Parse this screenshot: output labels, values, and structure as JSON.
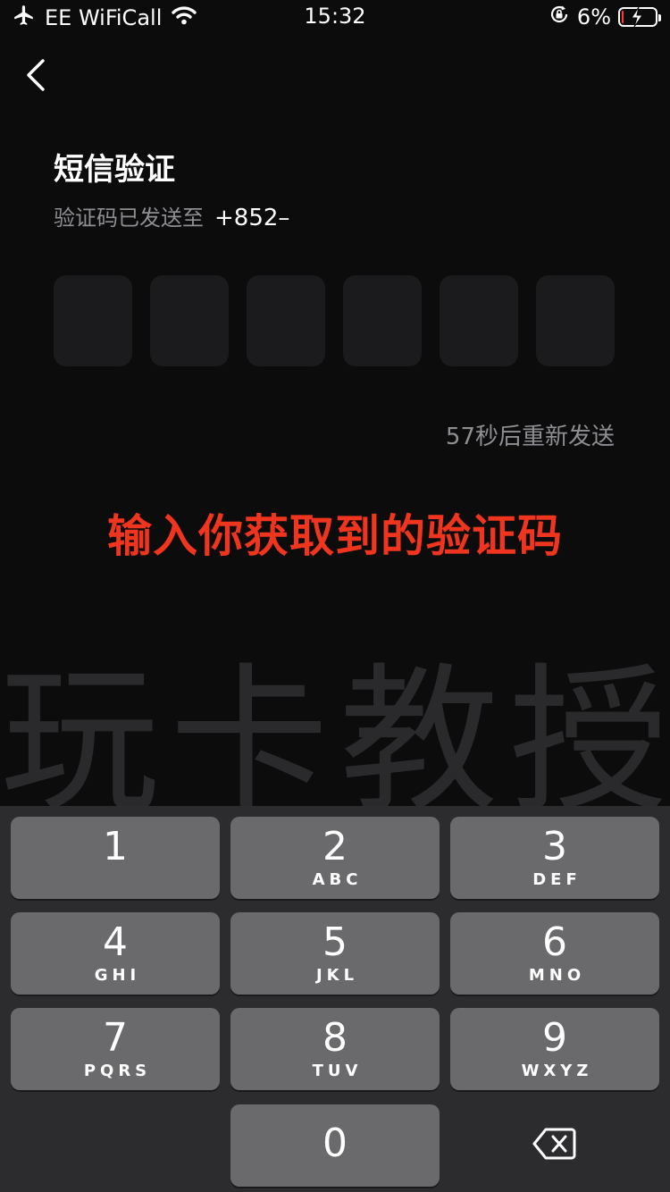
{
  "status_bar": {
    "carrier": "EE WiFiCall",
    "time": "15:32",
    "battery_percent": "6%",
    "battery_level": 0.06,
    "icons": [
      "airplane-icon",
      "wifi-icon",
      "orientation-lock-icon",
      "battery-charging-icon"
    ]
  },
  "header": {
    "back_icon": "chevron-left-icon",
    "title": "短信验证",
    "subtitle_prefix": "验证码已发送至",
    "phone": "+852–"
  },
  "code_input": {
    "length": 6
  },
  "resend_label": "57秒后重新发送",
  "annotation": "输入你获取到的验证码",
  "watermark": "玩卡教授",
  "keypad": {
    "keys": [
      {
        "digit": "1",
        "letters": ""
      },
      {
        "digit": "2",
        "letters": "ABC"
      },
      {
        "digit": "3",
        "letters": "DEF"
      },
      {
        "digit": "4",
        "letters": "GHI"
      },
      {
        "digit": "5",
        "letters": "JKL"
      },
      {
        "digit": "6",
        "letters": "MNO"
      },
      {
        "digit": "7",
        "letters": "PQRS"
      },
      {
        "digit": "8",
        "letters": "TUV"
      },
      {
        "digit": "9",
        "letters": "WXYZ"
      },
      {
        "digit": "0",
        "letters": ""
      }
    ],
    "delete_icon": "backspace-icon"
  },
  "colors": {
    "background": "#0c0c0d",
    "code_box": "#1b1b1d",
    "annotation": "#f0351f",
    "key": "#6a6a6c",
    "keypad_bg": "#2c2c2e"
  }
}
